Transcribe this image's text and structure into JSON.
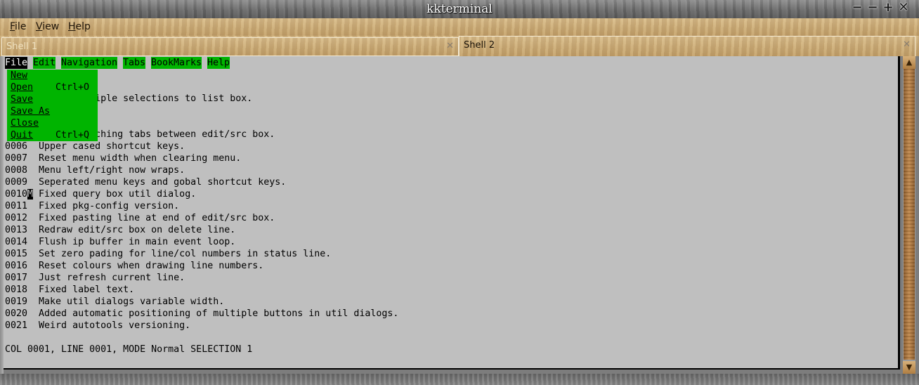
{
  "window": {
    "title": "kkterminal",
    "controls": {
      "minimize": "−",
      "shade": "−",
      "maximize": "+",
      "close": "✕"
    }
  },
  "menubar": [
    {
      "label": "File",
      "hotkey": "F",
      "rest": "ile"
    },
    {
      "label": "View",
      "hotkey": "V",
      "rest": "iew"
    },
    {
      "label": "Help",
      "hotkey": "H",
      "rest": "elp"
    }
  ],
  "tabs": [
    {
      "label": "Shell 1",
      "close": "✕",
      "active": false
    },
    {
      "label": "Shell 2",
      "close": "✕",
      "active": true
    }
  ],
  "terminal": {
    "menu": [
      {
        "label": "File",
        "active": true
      },
      {
        "label": "Edit",
        "active": false
      },
      {
        "label": "Navigation",
        "active": false
      },
      {
        "label": "Tabs",
        "active": false
      },
      {
        "label": "BookMarks",
        "active": false
      },
      {
        "label": "Help",
        "active": false
      }
    ],
    "file_menu": [
      {
        "label": "New",
        "shortcut": ""
      },
      {
        "label": "Open",
        "shortcut": "Ctrl+O"
      },
      {
        "label": "Save",
        "shortcut": ""
      },
      {
        "label": "Save As",
        "shortcut": ""
      },
      {
        "label": "Close",
        "shortcut": ""
      },
      {
        "label": "Quit",
        "shortcut": "Ctrl+Q"
      }
    ],
    "lines": [
      "",
      "",
      "                iple selections to list box.",
      "",
      "",
      "                ching tabs between edit/src box.",
      "0006  Upper cased shortcut keys.",
      "0007  Reset menu width when clearing menu.",
      "0008  Menu left/right now wraps.",
      "0009  Seperated menu keys and gobal shortcut keys.",
      "0010",
      "0011  Fixed pkg-config version.",
      "0012  Fixed pasting line at end of edit/src box.",
      "0013  Redraw edit/src box on delete line.",
      "0014  Flush ip buffer in main event loop.",
      "0015  Set zero pading for line/col numbers in status line.",
      "0016  Reset colours when drawing line numbers.",
      "0017  Just refresh current line.",
      "0018  Fixed label text.",
      "0019  Make util dialogs variable width.",
      "0020  Added automatic positioning of multiple buttons in util dialogs.",
      "0021  Weird autotools versioning."
    ],
    "cursor_line": {
      "prefix": "0010",
      "cursor_char": "M",
      "rest": " Fixed query box util dialog."
    },
    "status": "COL 0001, LINE 0001, MODE Normal SELECTION 1"
  },
  "scrollbar": {
    "up": "▲",
    "down": "▼"
  }
}
